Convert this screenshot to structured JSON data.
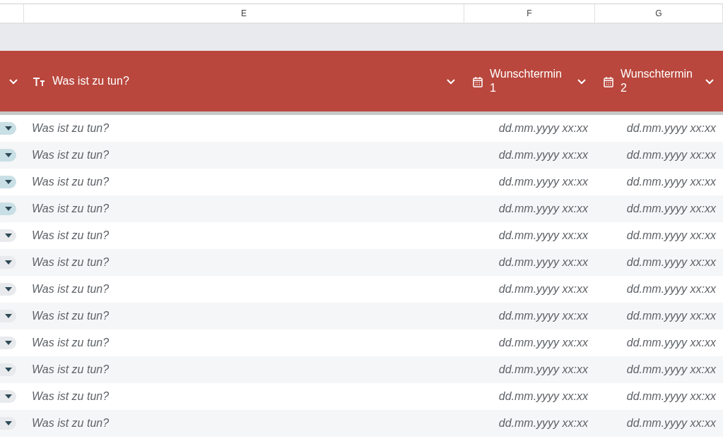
{
  "column_letters": [
    "E",
    "F",
    "G"
  ],
  "header": {
    "columns": [
      {
        "kind": "text",
        "label": "Was ist zu tun?"
      },
      {
        "kind": "date",
        "label": "Wunschtermin 1"
      },
      {
        "kind": "date",
        "label": "Wunschtermin 2"
      }
    ]
  },
  "rows": [
    {
      "color": "#c9dfe6",
      "task": "Was ist zu tun?",
      "date_1": "dd.mm.yyyy xx:xx",
      "date_2": "dd.mm.yyyy xx:xx"
    },
    {
      "color": "#c9dfe6",
      "task": "Was ist zu tun?",
      "date_1": "dd.mm.yyyy xx:xx",
      "date_2": "dd.mm.yyyy xx:xx"
    },
    {
      "color": "#c9dfe6",
      "task": "Was ist zu tun?",
      "date_1": "dd.mm.yyyy xx:xx",
      "date_2": "dd.mm.yyyy xx:xx"
    },
    {
      "color": "#c9dfe6",
      "task": "Was ist zu tun?",
      "date_1": "dd.mm.yyyy xx:xx",
      "date_2": "dd.mm.yyyy xx:xx"
    },
    {
      "color": "#e8eaed",
      "task": "Was ist zu tun?",
      "date_1": "dd.mm.yyyy xx:xx",
      "date_2": "dd.mm.yyyy xx:xx"
    },
    {
      "color": "#e8eaed",
      "task": "Was ist zu tun?",
      "date_1": "dd.mm.yyyy xx:xx",
      "date_2": "dd.mm.yyyy xx:xx"
    },
    {
      "color": "#e8eaed",
      "task": "Was ist zu tun?",
      "date_1": "dd.mm.yyyy xx:xx",
      "date_2": "dd.mm.yyyy xx:xx"
    },
    {
      "color": "#e8eaed",
      "task": "Was ist zu tun?",
      "date_1": "dd.mm.yyyy xx:xx",
      "date_2": "dd.mm.yyyy xx:xx"
    },
    {
      "color": "#e8eaed",
      "task": "Was ist zu tun?",
      "date_1": "dd.mm.yyyy xx:xx",
      "date_2": "dd.mm.yyyy xx:xx"
    },
    {
      "color": "#e8eaed",
      "task": "Was ist zu tun?",
      "date_1": "dd.mm.yyyy xx:xx",
      "date_2": "dd.mm.yyyy xx:xx"
    },
    {
      "color": "#e8eaed",
      "task": "Was ist zu tun?",
      "date_1": "dd.mm.yyyy xx:xx",
      "date_2": "dd.mm.yyyy xx:xx"
    },
    {
      "color": "#e8eaed",
      "task": "Was ist zu tun?",
      "date_1": "dd.mm.yyyy xx:xx",
      "date_2": "dd.mm.yyyy xx:xx"
    }
  ]
}
